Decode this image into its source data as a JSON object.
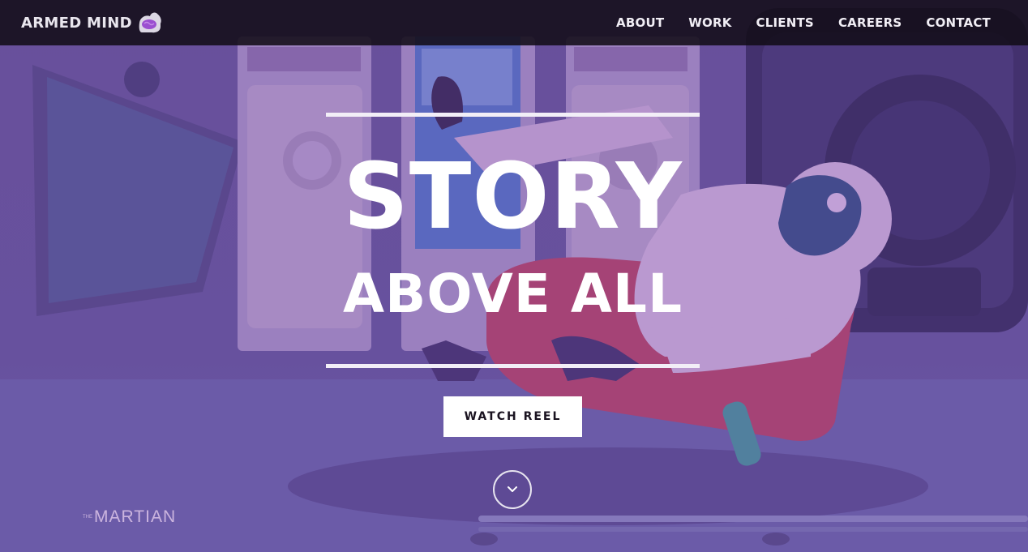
{
  "brand": {
    "name": "ARMED MIND",
    "logo_icon": "flexed-arm-brain-icon"
  },
  "nav": {
    "items": [
      {
        "label": "ABOUT"
      },
      {
        "label": "WORK"
      },
      {
        "label": "CLIENTS"
      },
      {
        "label": "CAREERS"
      },
      {
        "label": "CONTACT"
      }
    ]
  },
  "hero": {
    "title_line_1": "STORY",
    "title_line_2": "ABOVE ALL",
    "cta_label": "WATCH REEL",
    "scroll_icon": "chevron-down-icon",
    "caption_small": "THE",
    "caption": "MARTIAN"
  },
  "colors": {
    "topbar": "#120c18",
    "overlay_purple": "#6b559d",
    "text": "#ffffff",
    "logo_purple": "#9b4fd0"
  }
}
